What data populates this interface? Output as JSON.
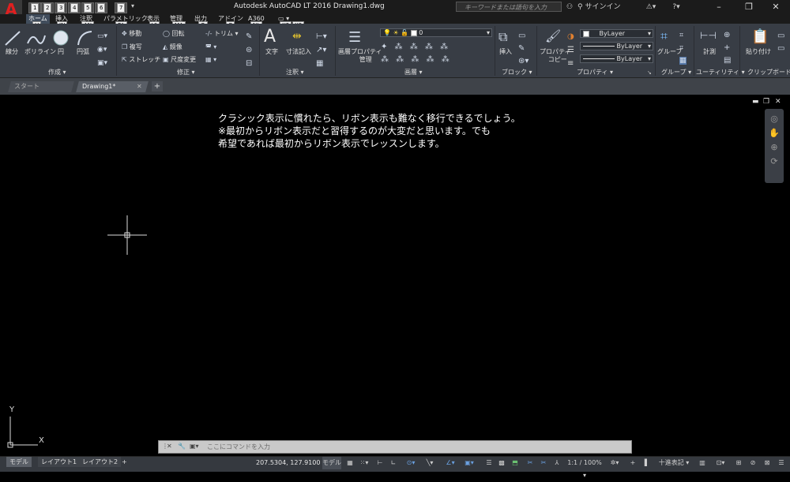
{
  "app": {
    "title": "Autodesk AutoCAD LT 2016    Drawing1.dwg",
    "app_button": "A",
    "app_button_sub": "LT"
  },
  "quick_access": {
    "items": [
      {
        "label": "1",
        "keytip": "1"
      },
      {
        "label": "2",
        "keytip": "2"
      },
      {
        "label": "3",
        "keytip": "3"
      },
      {
        "label": "4",
        "keytip": "4"
      },
      {
        "label": "5",
        "keytip": "5"
      },
      {
        "label": "6",
        "keytip": "6"
      },
      {
        "label": "7",
        "keytip": "7"
      }
    ]
  },
  "search": {
    "placeholder": "キーワードまたは語句を入力"
  },
  "signin": {
    "label": "サインイン"
  },
  "help_icon": "?",
  "ribbon_tabs": [
    {
      "label": "ホーム",
      "keytip": "H"
    },
    {
      "label": "挿入",
      "keytip": "IN"
    },
    {
      "label": "注釈",
      "keytip": "AN"
    },
    {
      "label": "パラメトリック",
      "keytip": "PA"
    },
    {
      "label": "表示",
      "keytip": "VI"
    },
    {
      "label": "管理",
      "keytip": "MA"
    },
    {
      "label": "出力",
      "keytip": "O"
    },
    {
      "label": "アドイン",
      "keytip": "G"
    },
    {
      "label": "A360",
      "keytip": "NL"
    }
  ],
  "extra_keytips": [
    "X2",
    "X3"
  ],
  "panels": {
    "draw": {
      "title": "作成 ▾",
      "tools": [
        {
          "label": "線分"
        },
        {
          "label": "ポリライン"
        },
        {
          "label": "円"
        },
        {
          "label": "円弧"
        }
      ]
    },
    "modify": {
      "title": "修正 ▾",
      "tools": [
        {
          "label": "移動"
        },
        {
          "label": "回転"
        },
        {
          "label": "トリム ▾"
        },
        {
          "label": "複写"
        },
        {
          "label": "鏡像"
        },
        {
          "label": "ストレッチ"
        },
        {
          "label": "尺度変更"
        }
      ]
    },
    "annotation": {
      "title": "注釈 ▾",
      "tools": [
        {
          "label": "文字"
        },
        {
          "label": "寸法記入"
        }
      ]
    },
    "layers": {
      "title": "画層 ▾",
      "props_label": "画層プロパティ",
      "props_label2": "管理",
      "current_layer": "0"
    },
    "block": {
      "title": "ブロック ▾",
      "insert": "挿入"
    },
    "properties": {
      "title": "プロパティ ▾",
      "match": "プロパティ",
      "match2": "コピー",
      "color": "ByLayer",
      "linetype": "ByLayer",
      "lineweight": "ByLayer"
    },
    "groups": {
      "title": "グループ ▾",
      "group": "グループ"
    },
    "utilities": {
      "title": "ユーティリティ ▾",
      "measure": "計測"
    },
    "clipboard": {
      "title": "クリップボード",
      "paste": "貼り付け"
    }
  },
  "file_tabs": [
    {
      "label": "スタート"
    },
    {
      "label": "Drawing1*"
    }
  ],
  "new_tab_icon": "+",
  "canvas": {
    "text_lines": [
      "クラシック表示に慣れたら、リボン表示も難なく移行できるでしょう。",
      "※最初からリボン表示だと習得するのが大変だと思います。でも",
      "希望であれば最初からリボン表示でレッスンします。"
    ],
    "ucs_x": "X",
    "ucs_y": "Y"
  },
  "command_line": {
    "placeholder": "ここにコマンドを入力"
  },
  "layout_tabs": [
    {
      "label": "モデル"
    },
    {
      "label": "レイアウト1"
    },
    {
      "label": "レイアウト2"
    }
  ],
  "status": {
    "coords": "207.5304, 127.9100",
    "model": "モデル",
    "scale": "1:1 / 100% ▾",
    "units": "十進表記"
  }
}
